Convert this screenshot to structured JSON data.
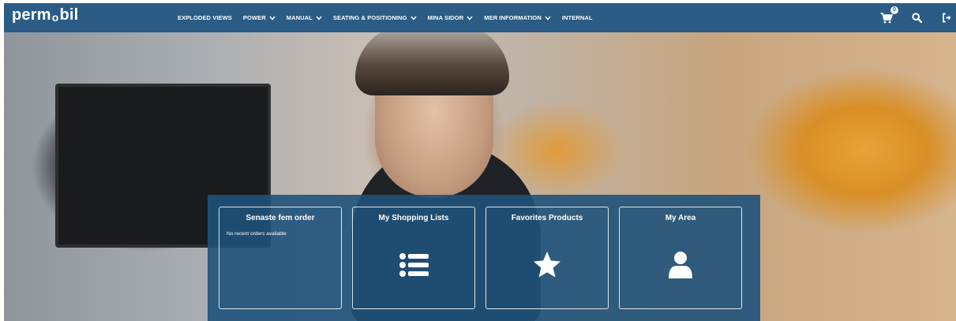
{
  "brand": {
    "logo_left": "perm",
    "logo_o": "o",
    "logo_right": "bil"
  },
  "nav": {
    "items": [
      {
        "label": "EXPLODED VIEWS",
        "dropdown": false
      },
      {
        "label": "POWER",
        "dropdown": true
      },
      {
        "label": "MANUAL",
        "dropdown": true
      },
      {
        "label": "SEATING & POSITIONING",
        "dropdown": true
      },
      {
        "label": "MINA SIDOR",
        "dropdown": true
      },
      {
        "label": "MER INFORMATION",
        "dropdown": true
      },
      {
        "label": "INTERNAL",
        "dropdown": false
      }
    ],
    "cart_count": "0",
    "icons": [
      "cart-icon",
      "search-icon",
      "logout-icon"
    ]
  },
  "tiles": [
    {
      "title": "Senaste fem order",
      "text": "No recent orders available"
    },
    {
      "title": "My Shopping Lists",
      "icon": "list-icon"
    },
    {
      "title": "Favorites Products",
      "icon": "star-icon"
    },
    {
      "title": "My Area",
      "icon": "user-icon"
    }
  ],
  "colors": {
    "navbar": "#2a5c86",
    "tiles_panel": "#1f527a",
    "text": "#ffffff"
  }
}
